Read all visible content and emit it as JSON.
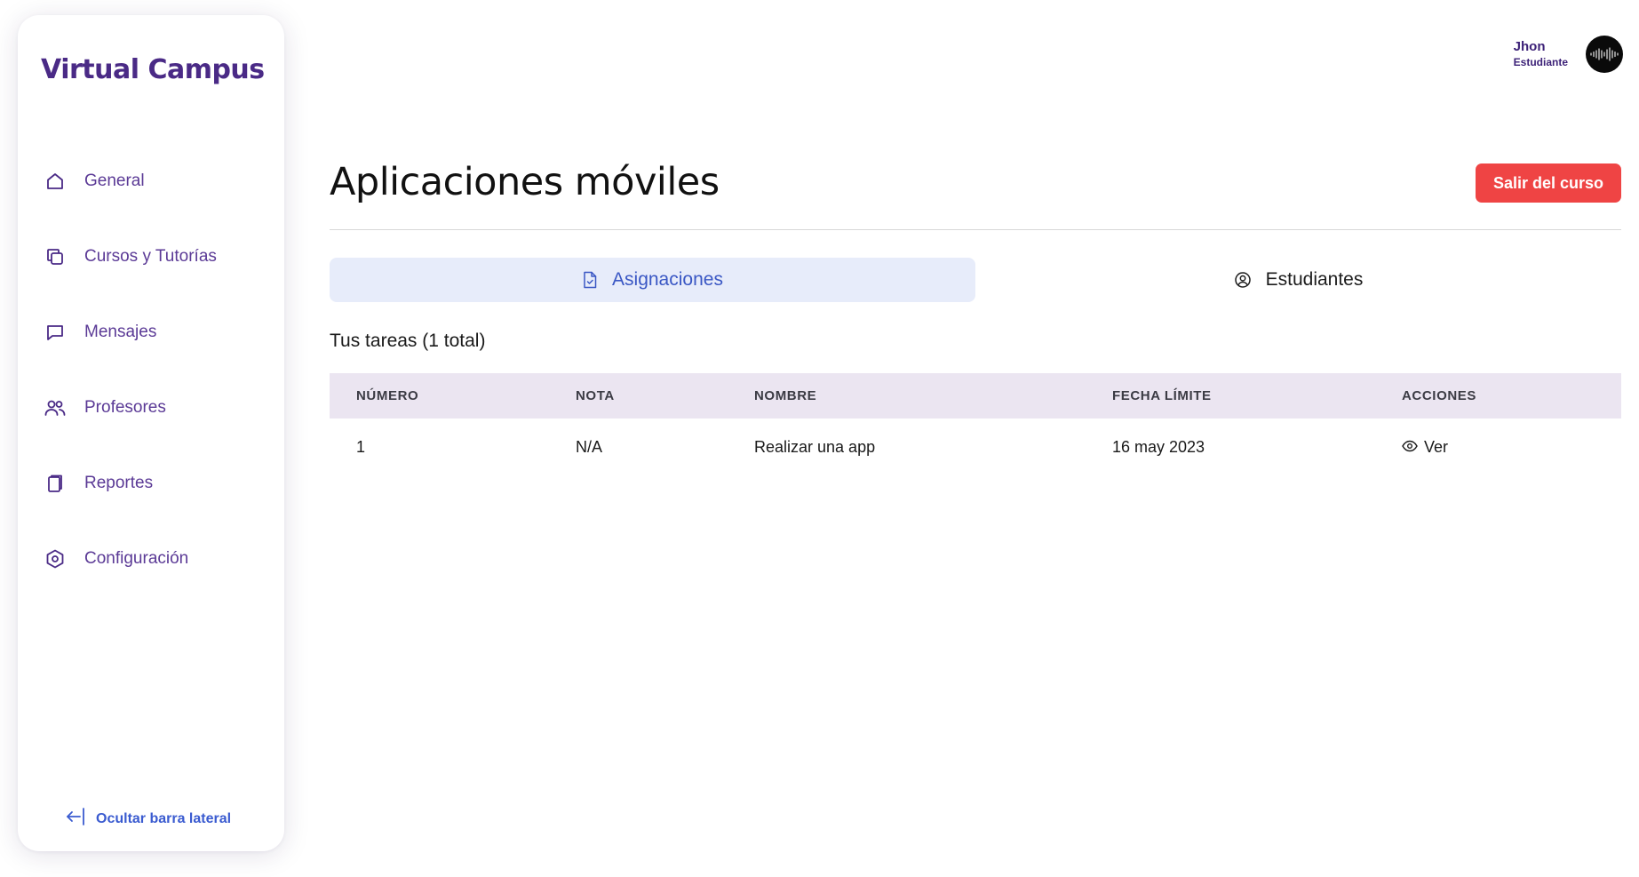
{
  "sidebar": {
    "brand": "Virtual Campus",
    "items": [
      {
        "label": "General",
        "icon": "home-icon"
      },
      {
        "label": "Cursos y Tutorías",
        "icon": "copy-icon"
      },
      {
        "label": "Mensajes",
        "icon": "message-icon"
      },
      {
        "label": "Profesores",
        "icon": "users-icon"
      },
      {
        "label": "Reportes",
        "icon": "document-icon"
      },
      {
        "label": "Configuración",
        "icon": "settings-icon"
      }
    ],
    "hide_label": "Ocultar barra lateral"
  },
  "user": {
    "name": "Jhon",
    "role": "Estudiante"
  },
  "page": {
    "title": "Aplicaciones móviles",
    "leave_button": "Salir del curso"
  },
  "tabs": [
    {
      "label": "Asignaciones",
      "icon": "file-check-icon",
      "active": true
    },
    {
      "label": "Estudiantes",
      "icon": "user-circle-icon",
      "active": false
    }
  ],
  "tasks": {
    "count_label": "Tus tareas (1 total)",
    "columns": [
      "NÚMERO",
      "NOTA",
      "NOMBRE",
      "FECHA LÍMITE",
      "ACCIONES"
    ],
    "rows": [
      {
        "numero": "1",
        "nota": "N/A",
        "nombre": "Realizar una app",
        "fecha": "16 may 2023",
        "accion": "Ver"
      }
    ]
  },
  "colors": {
    "brand": "#4a2a86",
    "accent": "#3a57c4",
    "danger": "#ef4444",
    "table_header": "#ebe5f1",
    "active_tab": "#e7ecfa"
  }
}
